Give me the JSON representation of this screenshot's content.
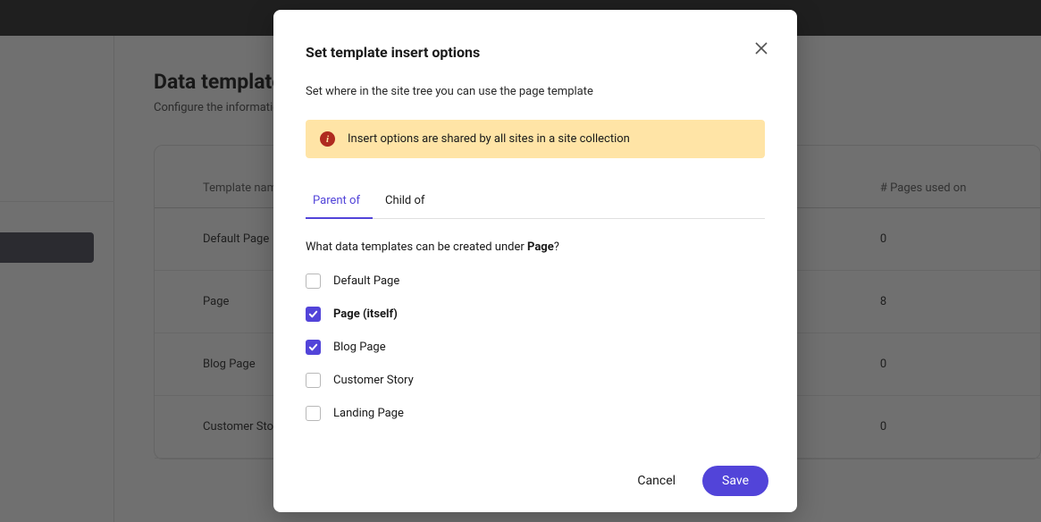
{
  "page": {
    "title": "Data templates",
    "subtitle": "Configure the information"
  },
  "table": {
    "headers": {
      "name": "Template name",
      "count": "# Pages used on"
    },
    "rows": [
      {
        "name": "Default Page",
        "count": "0"
      },
      {
        "name": "Page",
        "count": "8"
      },
      {
        "name": "Blog Page",
        "count": "0"
      },
      {
        "name": "Customer Story",
        "count": "0"
      }
    ]
  },
  "modal": {
    "title": "Set template insert options",
    "description": "Set where in the site tree you can use the page template",
    "info": "Insert options are shared by all sites in a site collection",
    "tabs": {
      "parent": "Parent of",
      "child": "Child of"
    },
    "question_prefix": "What data templates can be created under ",
    "question_subject": "Page",
    "question_suffix": "?",
    "options": [
      {
        "label": "Default Page",
        "checked": false,
        "bold": false
      },
      {
        "label": "Page (itself)",
        "checked": true,
        "bold": true
      },
      {
        "label": "Blog Page",
        "checked": true,
        "bold": false
      },
      {
        "label": "Customer Story",
        "checked": false,
        "bold": false
      },
      {
        "label": "Landing Page",
        "checked": false,
        "bold": false
      }
    ],
    "cancel": "Cancel",
    "save": "Save"
  }
}
